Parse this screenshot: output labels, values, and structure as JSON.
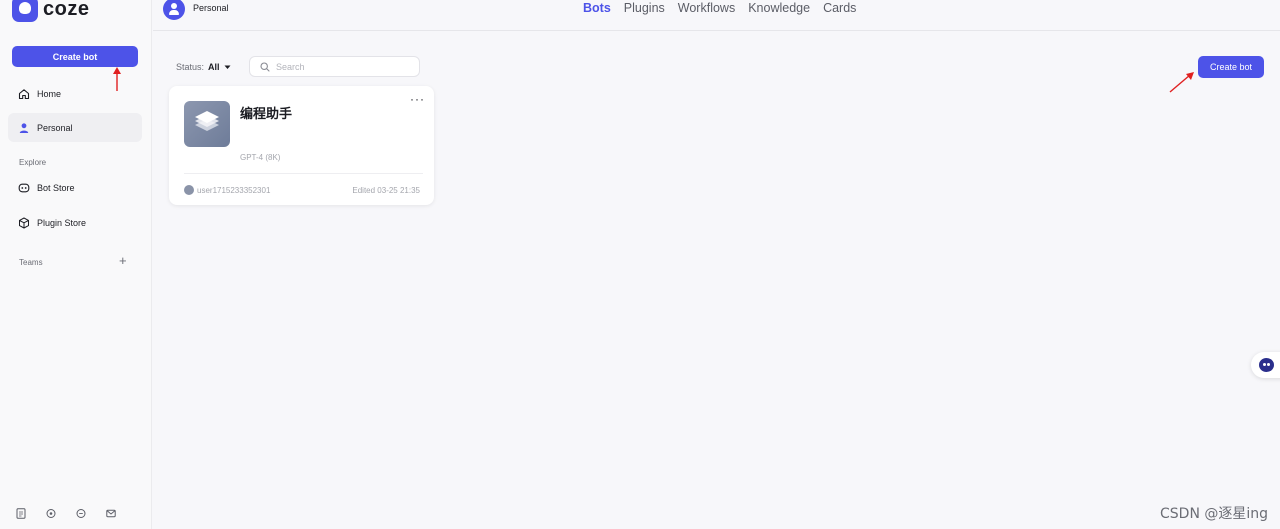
{
  "app": {
    "name": "coze"
  },
  "sidebar": {
    "create_label": "Create bot",
    "items": [
      {
        "label": "Home",
        "icon": "home-icon"
      },
      {
        "label": "Personal",
        "icon": "user-icon",
        "active": true
      },
      {
        "label": "Bot Store",
        "icon": "bot-icon"
      },
      {
        "label": "Plugin Store",
        "icon": "cube-icon"
      }
    ],
    "explore_label": "Explore",
    "teams_label": "Teams",
    "bottom_icons": [
      "doc-icon",
      "help-icon",
      "chat-icon",
      "mail-icon"
    ]
  },
  "header": {
    "workspace": "Personal",
    "tabs": [
      "Bots",
      "Plugins",
      "Workflows",
      "Knowledge",
      "Cards"
    ],
    "active_tab": "Bots"
  },
  "toolbar": {
    "status_label": "Status:",
    "status_value": "All",
    "search_placeholder": "Search",
    "create_label": "Create bot"
  },
  "bots": [
    {
      "name": "编程助手",
      "model": "GPT-4 (8K)",
      "user": "user1715233352301",
      "edited": "Edited 03-25 21:35"
    }
  ],
  "watermark": "CSDN @逐星ing",
  "colors": {
    "accent": "#4d53e8",
    "arrow": "#e02020"
  }
}
